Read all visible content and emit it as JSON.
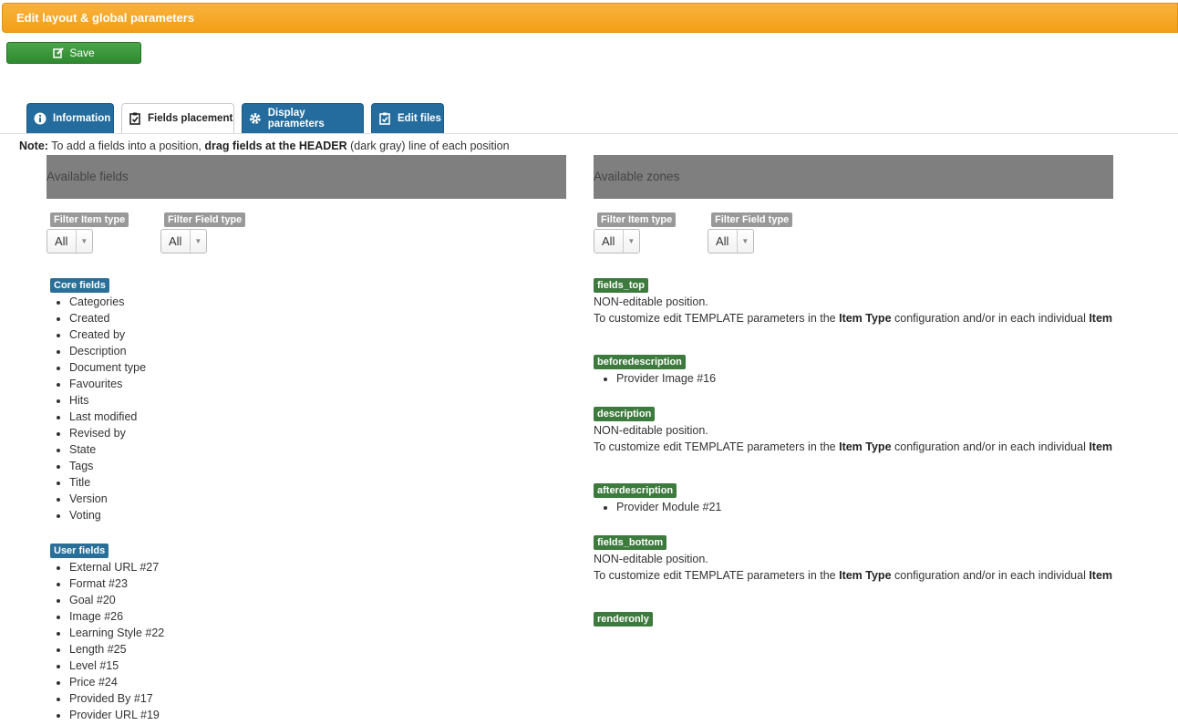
{
  "header": {
    "title": "Edit layout & global parameters"
  },
  "toolbar": {
    "save_label": "Save"
  },
  "tabs": [
    {
      "label": "Information",
      "icon": "info-icon",
      "active": false
    },
    {
      "label": "Fields placement",
      "icon": "clipboard-check-icon",
      "active": true
    },
    {
      "label": "Display parameters",
      "icon": "gear-icon",
      "active": false
    },
    {
      "label": "Edit files",
      "icon": "clipboard-check-icon",
      "active": false
    }
  ],
  "note": {
    "prefix": "Note:",
    "text1": " To add a fields into a position, ",
    "bold": "drag fields at the HEADER",
    "text2": " (dark gray) line of each position"
  },
  "left": {
    "title": "Available fields",
    "filter_item_label": "Filter Item type",
    "filter_item_value": "All",
    "filter_field_label": "Filter Field type",
    "filter_field_value": "All",
    "core_label": "Core fields",
    "core_fields": [
      "Categories",
      "Created",
      "Created by",
      "Description",
      "Document type",
      "Favourites",
      "Hits",
      "Last modified",
      "Revised by",
      "State",
      "Tags",
      "Title",
      "Version",
      "Voting"
    ],
    "user_label": "User fields",
    "user_fields": [
      "External URL #27",
      "Format #23",
      "Goal #20",
      "Image #26",
      "Learning Style #22",
      "Length #25",
      "Level #15",
      "Price #24",
      "Provided By #17",
      "Provider URL #19"
    ]
  },
  "right": {
    "title": "Available zones",
    "filter_item_label": "Filter Item type",
    "filter_item_value": "All",
    "filter_field_label": "Filter Field type",
    "filter_field_value": "All",
    "noneditable": "NON-editable position.",
    "customize_a": "To customize edit TEMPLATE parameters in the ",
    "customize_b": "Item Type",
    "customize_c": " configuration and/or in each individual ",
    "customize_d": "Item",
    "zones": {
      "fields_top": "fields_top",
      "beforedescription": "beforedescription",
      "beforedescription_item": "Provider Image #16",
      "description": "description",
      "afterdescription": "afterdescription",
      "afterdescription_item": "Provider Module #21",
      "fields_bottom": "fields_bottom",
      "renderonly": "renderonly"
    }
  }
}
